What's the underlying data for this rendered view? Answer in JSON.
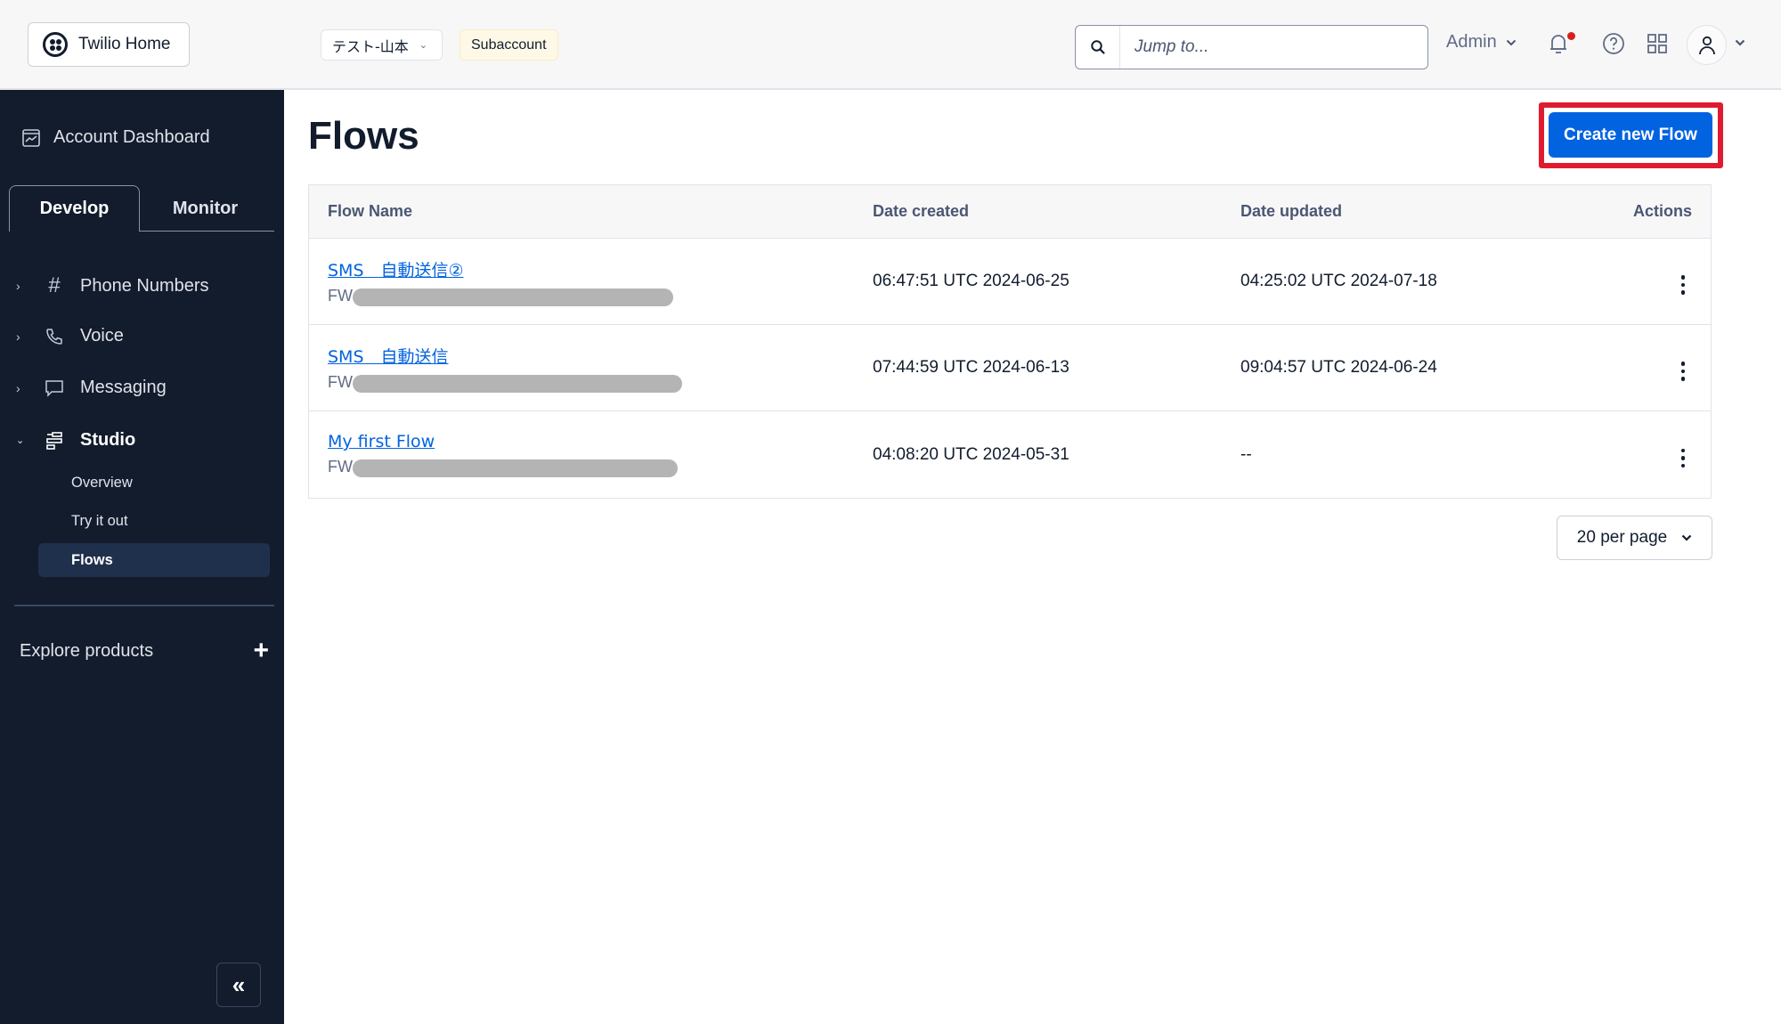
{
  "header": {
    "home_label": "Twilio Home",
    "account_name": "テスト-山本",
    "account_badge": "Subaccount",
    "search_placeholder": "Jump to...",
    "role_label": "Admin",
    "icons": [
      "bell-icon",
      "help-icon",
      "apps-grid-icon",
      "user-avatar-icon"
    ],
    "notification_dot_color": "#d61f1f"
  },
  "sidebar": {
    "dashboard_label": "Account Dashboard",
    "tabs": [
      {
        "label": "Develop",
        "active": true
      },
      {
        "label": "Monitor",
        "active": false
      }
    ],
    "items": [
      {
        "label": "Phone Numbers",
        "icon": "hash-icon",
        "expanded": false
      },
      {
        "label": "Voice",
        "icon": "phone-icon",
        "expanded": false
      },
      {
        "label": "Messaging",
        "icon": "chat-icon",
        "expanded": false
      },
      {
        "label": "Studio",
        "icon": "studio-icon",
        "expanded": true
      }
    ],
    "studio_subitems": [
      {
        "label": "Overview",
        "active": false
      },
      {
        "label": "Try it out",
        "active": false
      },
      {
        "label": "Flows",
        "active": true
      }
    ],
    "explore_label": "Explore products",
    "explore_icon": "+",
    "collapse_icon": "«"
  },
  "main": {
    "title": "Flows",
    "create_button_label": "Create new Flow",
    "annotation_color": "#e01b2f",
    "accent_color": "#0263e0",
    "table": {
      "columns": [
        "Flow Name",
        "Date created",
        "Date updated",
        "Actions"
      ],
      "rows": [
        {
          "name": "SMS　自動送信②",
          "sid_prefix": "FW",
          "date_created": "06:47:51 UTC 2024-06-25",
          "date_updated": "04:25:02 UTC 2024-07-18"
        },
        {
          "name": "SMS　自動送信",
          "sid_prefix": "FW",
          "date_created": "07:44:59 UTC 2024-06-13",
          "date_updated": "09:04:57 UTC 2024-06-24"
        },
        {
          "name": "My first Flow",
          "sid_prefix": "FW",
          "date_created": "04:08:20 UTC 2024-05-31",
          "date_updated": "--"
        }
      ]
    },
    "per_page_label": "20 per page"
  }
}
